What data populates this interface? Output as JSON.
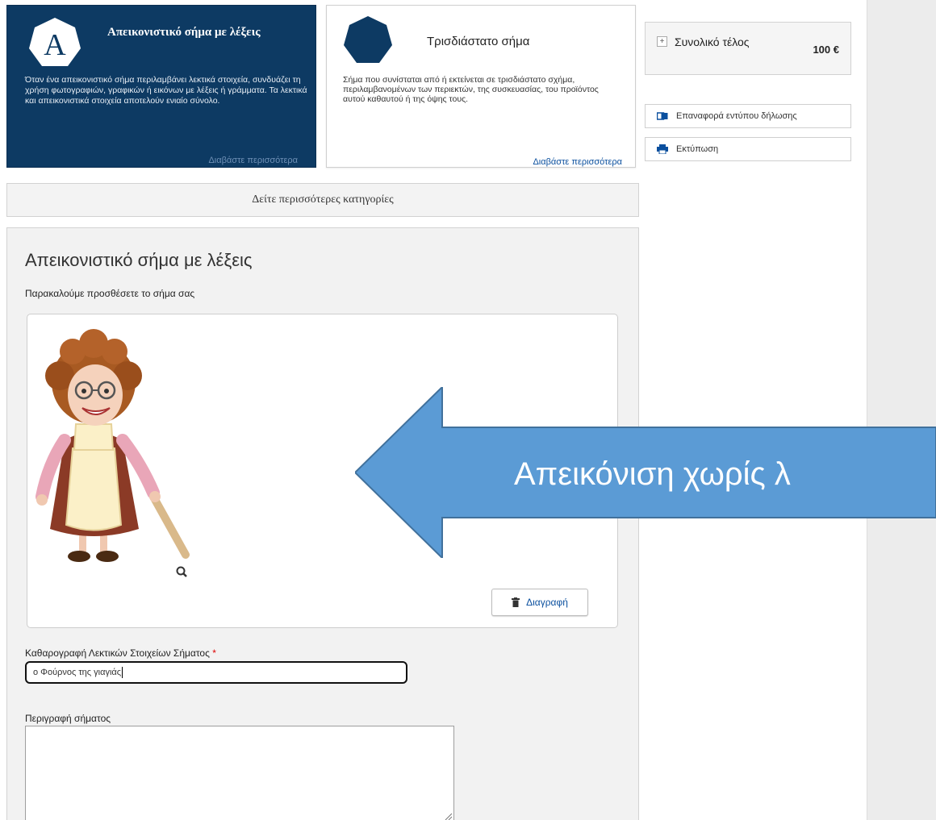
{
  "categories": [
    {
      "title": "Απεικονιστικό σήμα με λέξεις",
      "badge_letter": "A",
      "description": "Όταν ένα απεικονιστικό σήμα περιλαμβάνει λεκτικά στοιχεία, συνδυάζει τη χρήση φωτογραφιών, γραφικών ή εικόνων με λέξεις ή γράμματα. Τα λεκτικά και απεικονιστικά στοιχεία αποτελούν ενιαίο σύνολο.",
      "more": "Διαβάστε περισσότερα"
    },
    {
      "title": "Τρισδιάστατο σήμα",
      "description": "Σήμα που συνίσταται από ή εκτείνεται σε τρισδιάστατο σχήμα, περιλαμβανομένων των περιεκτών, της συσκευασίας, του προϊόντος αυτού καθαυτού ή της όψης τους.",
      "more": "Διαβάστε περισσότερα"
    }
  ],
  "more_categories": "Δείτε περισσότερες κατηγορίες",
  "sidebar": {
    "total_toggle": "+",
    "total_label": "Συνολικό τέλος",
    "total_amount": "100 €",
    "reload_label": "Επαναφορά εντύπου δήλωσης",
    "print_label": "Εκτύπωση"
  },
  "form": {
    "title": "Απεικονιστικό σήμα με λέξεις",
    "subtitle": "Παρακαλούμε προσθέσετε το σήμα σας",
    "delete_label": "Διαγραφή",
    "transcription_label": "Καθαρογραφή Λεκτικών Στοιχείων Σήματος",
    "required_mark": "*",
    "transcription_value": "ο Φούρνος της γιαγιάς",
    "description_label": "Περιγραφή σήματος",
    "description_value": ""
  },
  "annotation": {
    "text": "Απεικόνιση χωρίς λ",
    "color": "#5b9bd5"
  },
  "colors": {
    "dark_card": "#0d3a63",
    "link": "#0a4f9e"
  },
  "icons": [
    "letter-a-badge-icon",
    "heptagon-icon",
    "reload-form-icon",
    "printer-icon",
    "trash-icon",
    "zoom-icon"
  ]
}
